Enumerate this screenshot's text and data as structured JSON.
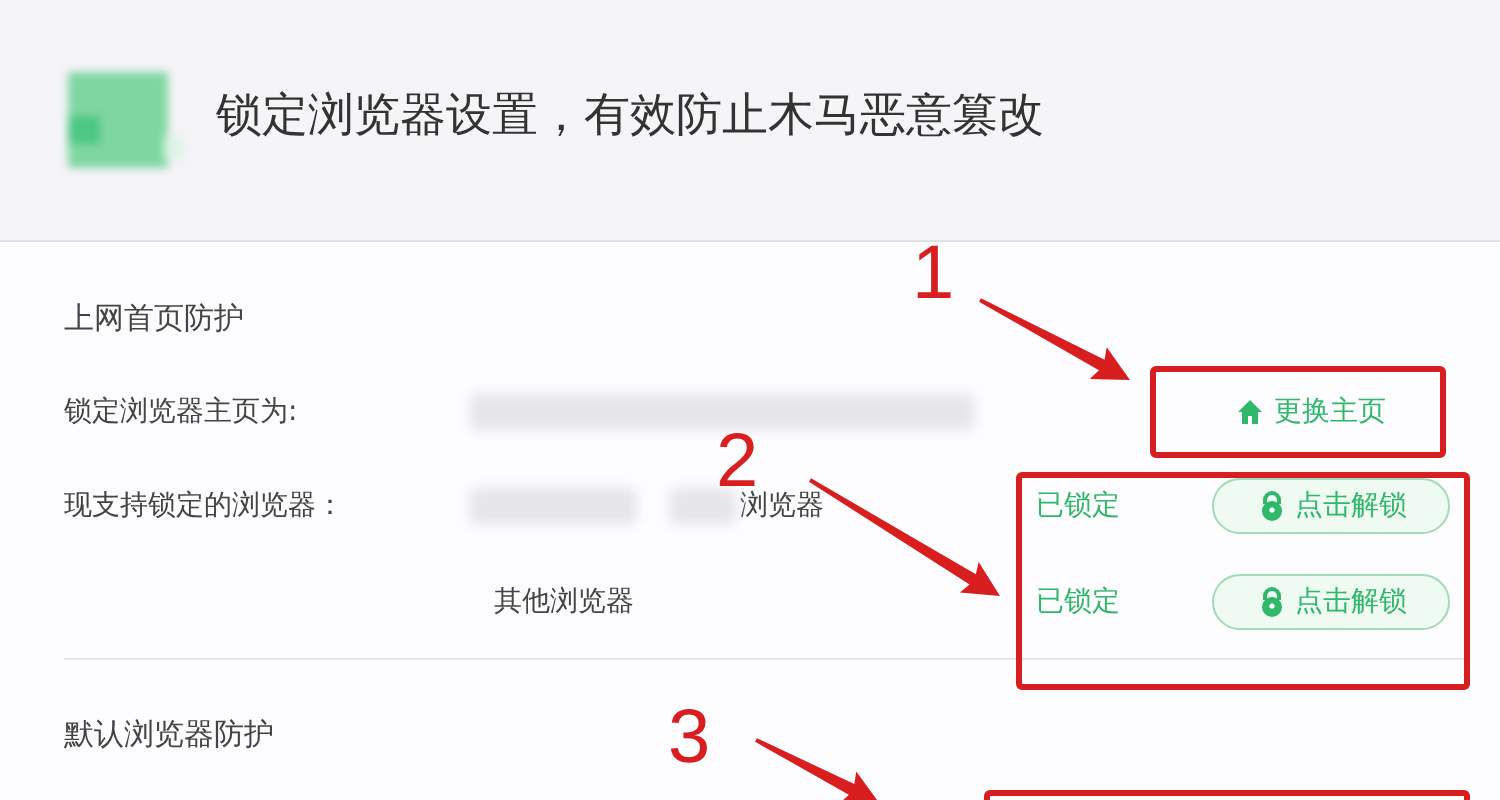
{
  "header": {
    "title": "锁定浏览器设置，有效防止木马恶意篡改"
  },
  "sections": [
    {
      "title": "上网首页防护",
      "rows": [
        {
          "kind": "homepage",
          "label": "锁定浏览器主页为:",
          "redacted": true,
          "button": "更换主页"
        },
        {
          "kind": "browser",
          "label": "现支持锁定的浏览器：",
          "redacted": true,
          "browser": "浏览器",
          "status": "已锁定",
          "button": "点击解锁"
        },
        {
          "kind": "browser",
          "redacted": false,
          "browser": "其他浏览器",
          "status": "已锁定",
          "button": "点击解锁"
        }
      ]
    },
    {
      "title": "默认浏览器防护"
    }
  ],
  "annotations": [
    {
      "label": "1"
    },
    {
      "label": "2"
    },
    {
      "label": "3"
    }
  ]
}
